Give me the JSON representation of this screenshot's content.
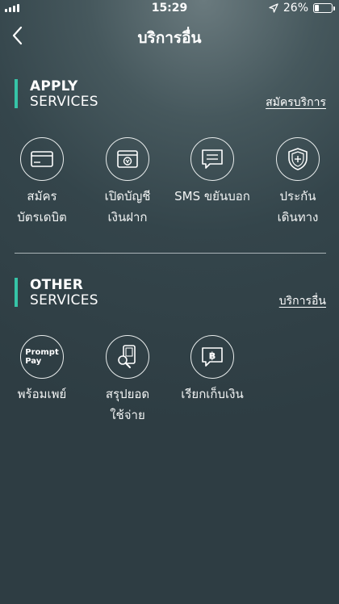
{
  "status_bar": {
    "time": "15:29",
    "battery": "26%",
    "battery_level": 0.26
  },
  "nav": {
    "title": "บริการอื่น"
  },
  "apply": {
    "title_line1": "APPLY",
    "title_line2": "SERVICES",
    "link": "สมัครบริการ",
    "items": [
      {
        "label": "สมัคร\nบัตรเดบิต",
        "icon": "card-icon"
      },
      {
        "label": "เปิดบัญชี\nเงินฝาก",
        "icon": "passbook-icon"
      },
      {
        "label": "SMS ขยันบอก",
        "icon": "chat-message-icon"
      },
      {
        "label": "ประกัน\nเดินทาง",
        "icon": "shield-plus-icon"
      }
    ]
  },
  "other": {
    "title_line1": "OTHER",
    "title_line2": "SERVICES",
    "link": "บริการอื่น",
    "items": [
      {
        "label": "พร้อมเพย์",
        "icon": "promptpay-icon",
        "icon_text_1": "Prompt",
        "icon_text_2": "Pay"
      },
      {
        "label": "สรุปยอด\nใช้จ่าย",
        "icon": "phone-search-icon"
      },
      {
        "label": "เรียกเก็บเงิน",
        "icon": "baht-bubble-icon"
      }
    ]
  }
}
